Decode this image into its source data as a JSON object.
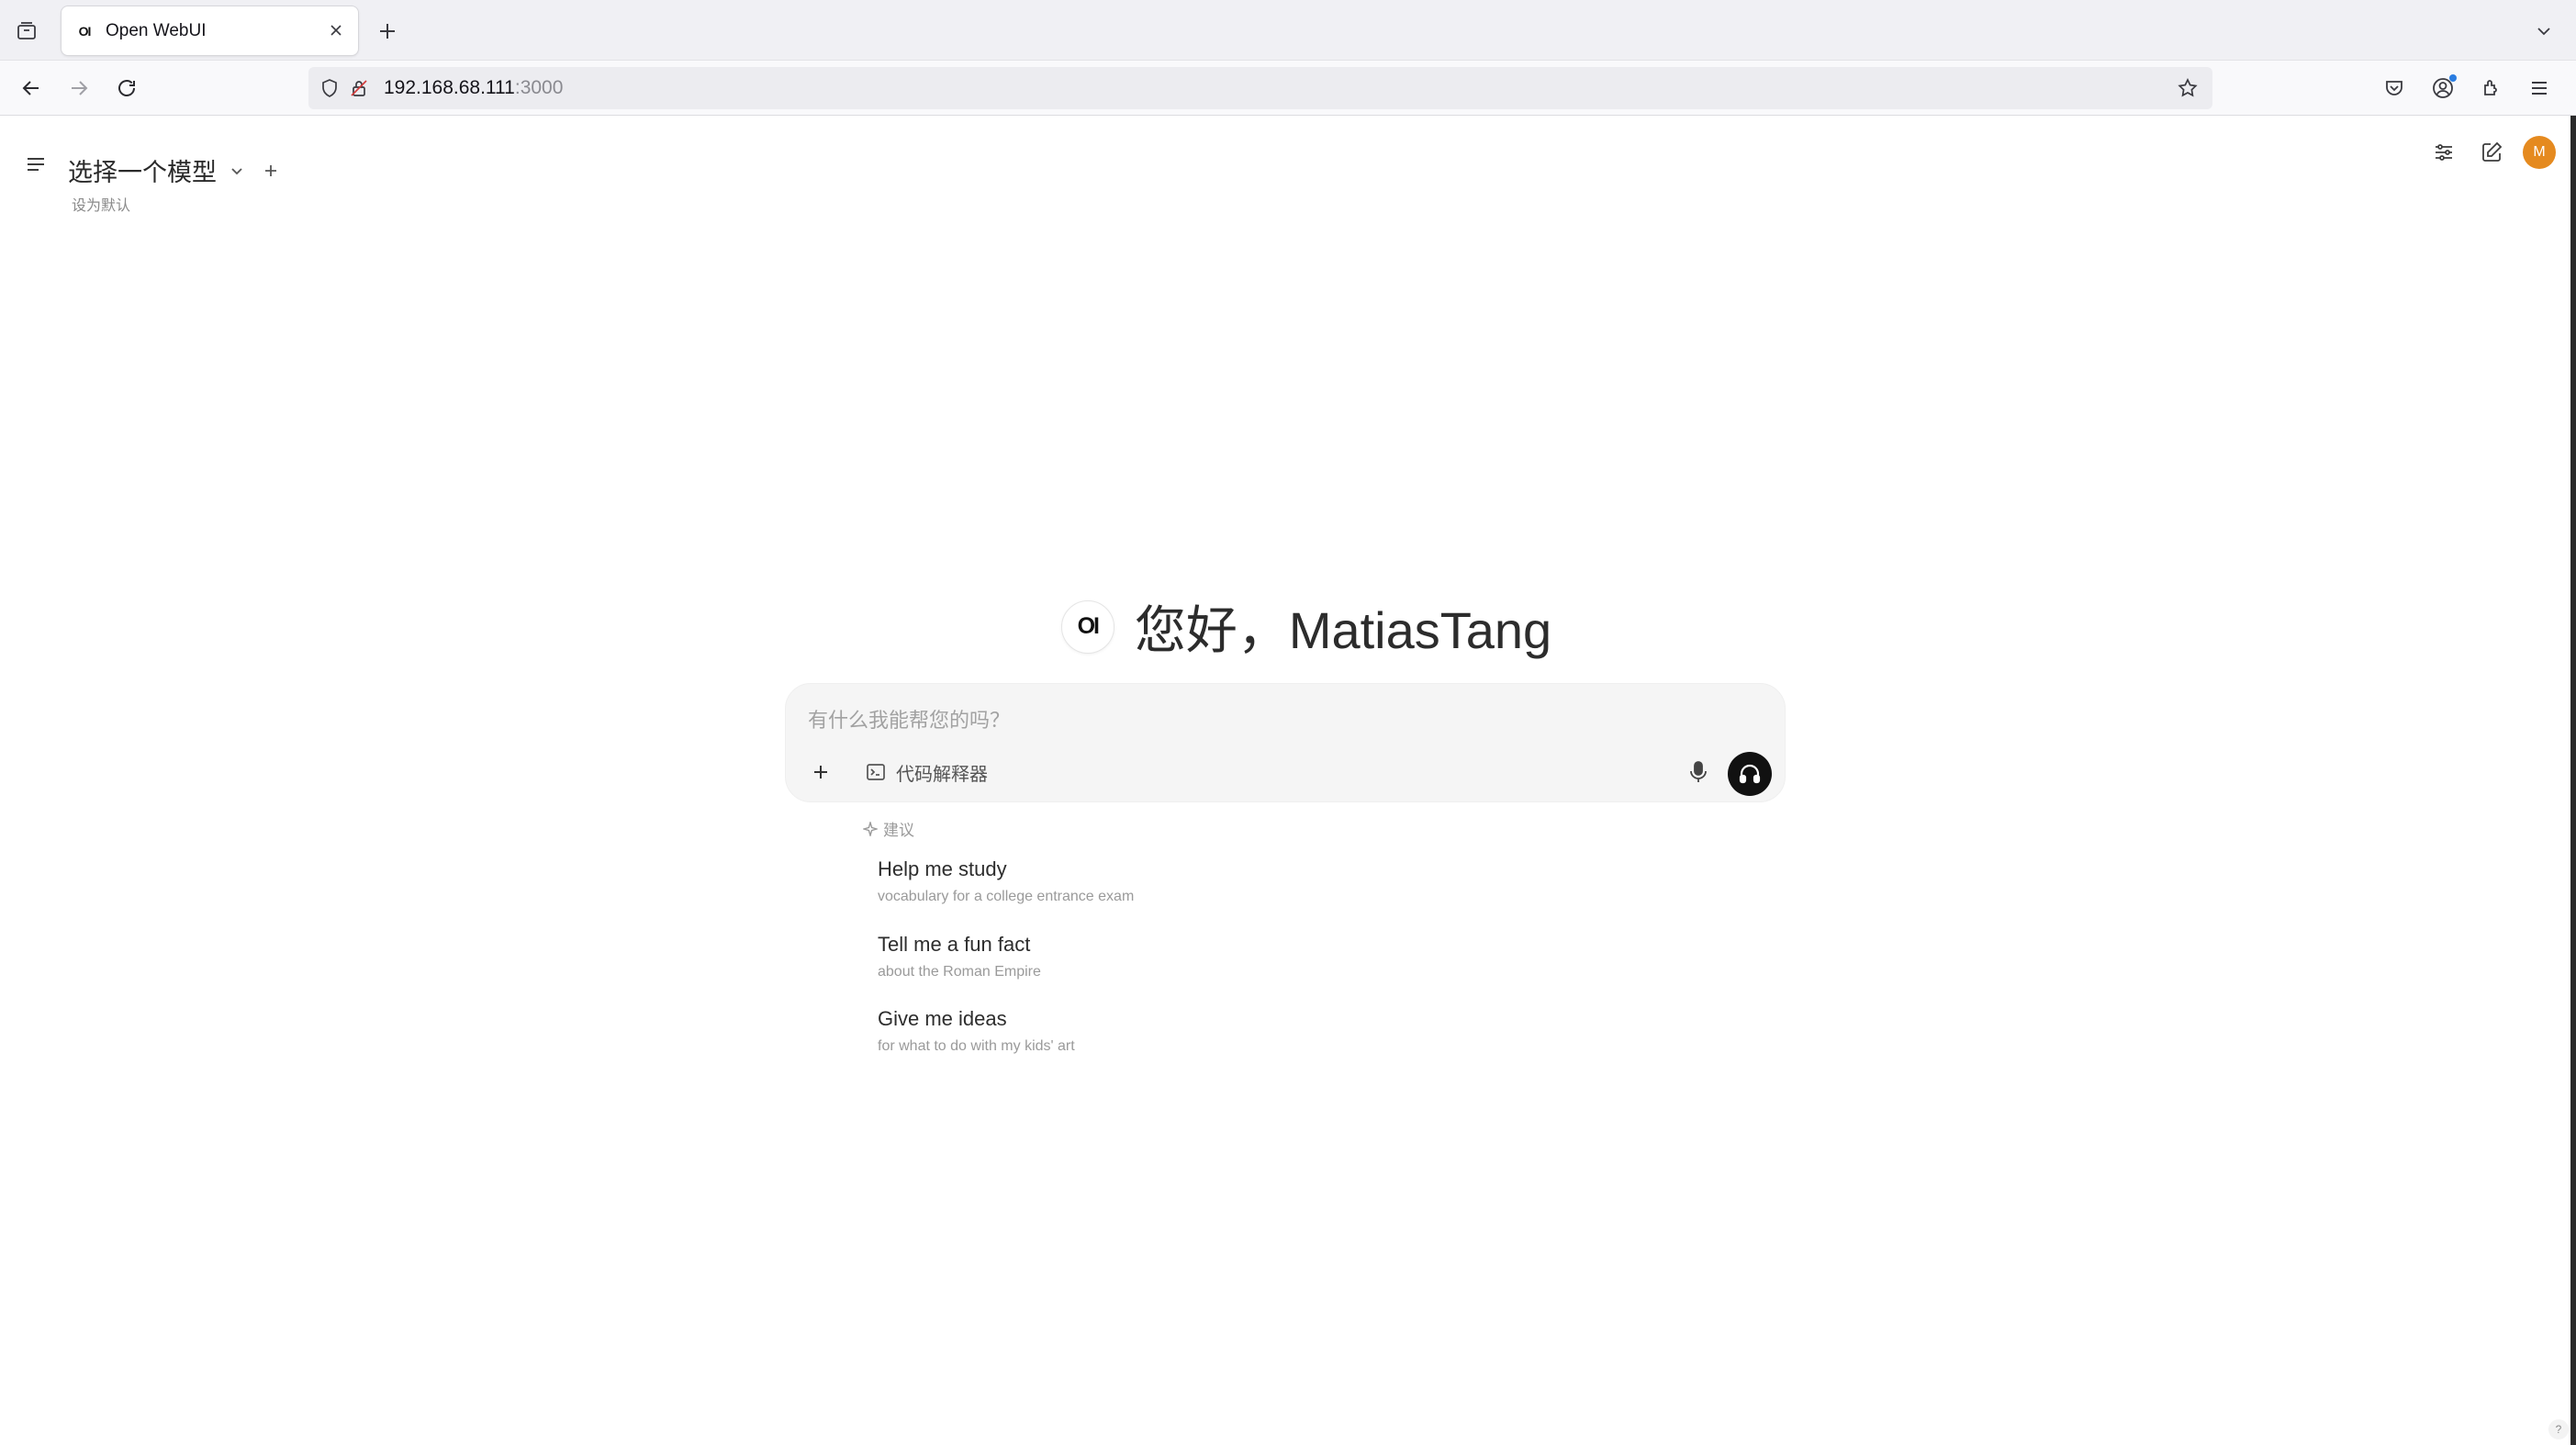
{
  "browser": {
    "tab_title": "Open WebUI",
    "tab_favicon": "OI",
    "url_host": "192.168.68.111",
    "url_port": ":3000"
  },
  "topbar": {
    "model_selector_label": "选择一个模型",
    "set_default_label": "设为默认",
    "avatar_initial": "M",
    "avatar_color": "#e58a1f"
  },
  "main": {
    "logo_text": "OI",
    "greeting": "您好，MatiasTang",
    "input_placeholder": "有什么我能帮您的吗？",
    "code_interpreter_label": "代码解释器",
    "suggestions_header": "建议",
    "suggestions": [
      {
        "title": "Help me study",
        "subtitle": "vocabulary for a college entrance exam"
      },
      {
        "title": "Tell me a fun fact",
        "subtitle": "about the Roman Empire"
      },
      {
        "title": "Give me ideas",
        "subtitle": "for what to do with my kids' art"
      }
    ],
    "help_label": "?"
  }
}
